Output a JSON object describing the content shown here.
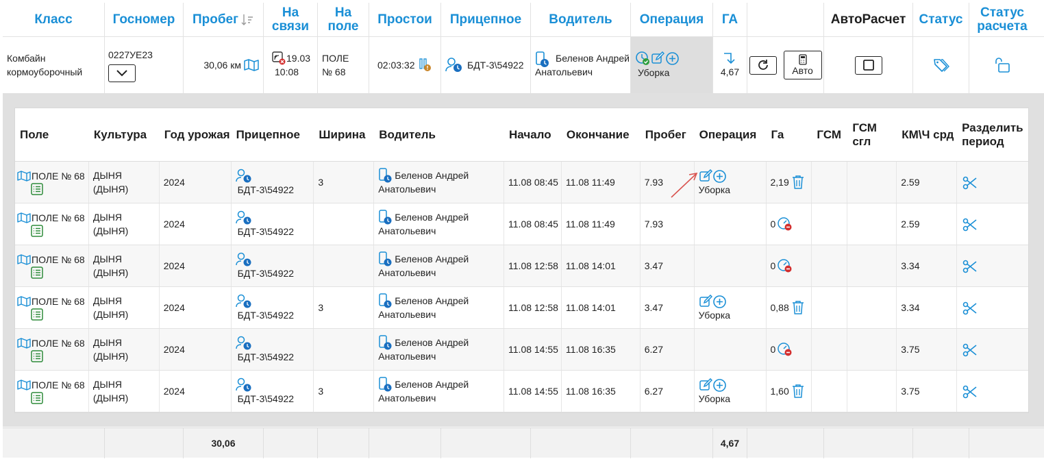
{
  "colors": {
    "accent": "#1a8fd6",
    "ok_green": "#2e9e3e",
    "danger": "#d32f2f",
    "list_green": "#2e8b3a",
    "arrow": "#d9534f"
  },
  "header": {
    "columns": {
      "class": "Класс",
      "plate": "Госномер",
      "mileage": "Пробег",
      "online": "На связи",
      "in_field": "На поле",
      "idle": "Простои",
      "trailer": "Прицепное",
      "driver": "Водитель",
      "operation": "Операция",
      "ha": "ГА",
      "autocalc": "АвтоРасчет",
      "status": "Статус",
      "calc_status": "Статус расчета"
    }
  },
  "vehicle": {
    "class": "Комбайн кормоуборочный",
    "plate": "0227УЕ23",
    "mileage": "30,06 км",
    "online_date": "19.03",
    "online_time": "10:08",
    "field": "ПОЛЕ № 68",
    "idle": "02:03:32",
    "trailer": "БДТ-3\\54922",
    "driver": "Беленов Андрей Анатольевич",
    "operation": "Уборка",
    "ha": "4,67",
    "auto_button": "Авто"
  },
  "table": {
    "headers": [
      "Поле",
      "Культура",
      "Год урожая",
      "Прицепное",
      "Ширина",
      "Водитель",
      "Начало",
      "Окончание",
      "Пробег",
      "Операция",
      "Га",
      "ГСМ",
      "ГСМ сгл",
      "КМ\\Ч срд",
      "Разделить период"
    ],
    "rows": [
      {
        "field": "ПОЛЕ № 68",
        "culture": "ДЫНЯ (ДЫНЯ)",
        "year": "2024",
        "trailer": "БДТ-3\\54922",
        "width": "3",
        "driver": "Беленов Андрей Анатольевич",
        "start": "11.08 08:45",
        "end": "11.08 11:49",
        "mileage": "7.93",
        "operation": "Уборка",
        "has_op": true,
        "ha": "2,19",
        "ha_kind": "trash",
        "kmh": "2.59"
      },
      {
        "field": "ПОЛЕ № 68",
        "culture": "ДЫНЯ (ДЫНЯ)",
        "year": "2024",
        "trailer": "БДТ-3\\54922",
        "width": "",
        "driver": "Беленов Андрей Анатольевич",
        "start": "11.08 08:45",
        "end": "11.08 11:49",
        "mileage": "7.93",
        "operation": "",
        "has_op": false,
        "ha": "0",
        "ha_kind": "gauge",
        "kmh": "2.59"
      },
      {
        "field": "ПОЛЕ № 68",
        "culture": "ДЫНЯ (ДЫНЯ)",
        "year": "2024",
        "trailer": "БДТ-3\\54922",
        "width": "",
        "driver": "Беленов Андрей Анатольевич",
        "start": "11.08 12:58",
        "end": "11.08 14:01",
        "mileage": "3.47",
        "operation": "",
        "has_op": false,
        "ha": "0",
        "ha_kind": "gauge",
        "kmh": "3.34"
      },
      {
        "field": "ПОЛЕ № 68",
        "culture": "ДЫНЯ (ДЫНЯ)",
        "year": "2024",
        "trailer": "БДТ-3\\54922",
        "width": "3",
        "driver": "Беленов Андрей Анатольевич",
        "start": "11.08 12:58",
        "end": "11.08 14:01",
        "mileage": "3.47",
        "operation": "Уборка",
        "has_op": true,
        "ha": "0,88",
        "ha_kind": "trash",
        "kmh": "3.34"
      },
      {
        "field": "ПОЛЕ № 68",
        "culture": "ДЫНЯ (ДЫНЯ)",
        "year": "2024",
        "trailer": "БДТ-3\\54922",
        "width": "",
        "driver": "Беленов Андрей Анатольевич",
        "start": "11.08 14:55",
        "end": "11.08 16:35",
        "mileage": "6.27",
        "operation": "",
        "has_op": false,
        "ha": "0",
        "ha_kind": "gauge",
        "kmh": "3.75"
      },
      {
        "field": "ПОЛЕ № 68",
        "culture": "ДЫНЯ (ДЫНЯ)",
        "year": "2024",
        "trailer": "БДТ-3\\54922",
        "width": "3",
        "driver": "Беленов Андрей Анатольевич",
        "start": "11.08 14:55",
        "end": "11.08 16:35",
        "mileage": "6.27",
        "operation": "Уборка",
        "has_op": true,
        "ha": "1,60",
        "ha_kind": "trash",
        "kmh": "3.75"
      }
    ]
  },
  "footer": {
    "mileage_total": "30,06",
    "ha_total": "4,67"
  }
}
